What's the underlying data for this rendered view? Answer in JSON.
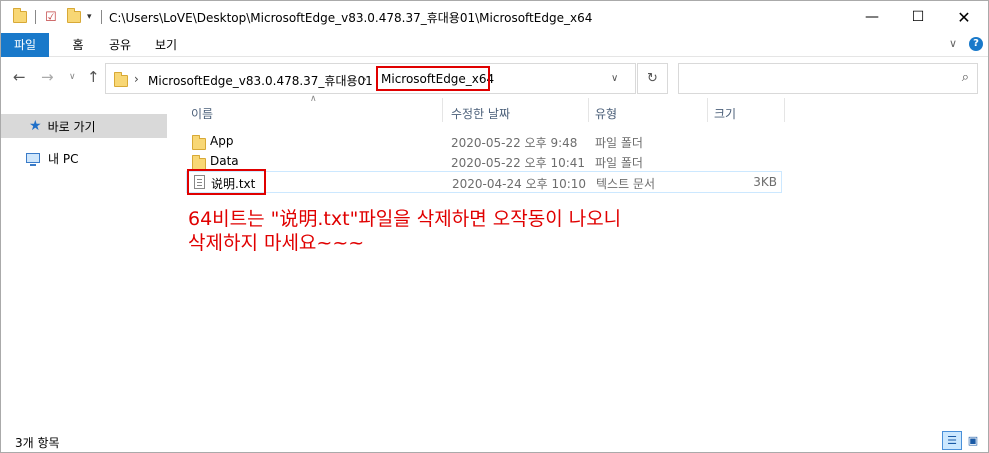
{
  "title_bar": {
    "path": "C:\\Users\\LoVE\\Desktop\\MicrosoftEdge_v83.0.478.37_휴대용01\\MicrosoftEdge_x64",
    "minimize_icon": "minimize-icon",
    "maximize_icon": "maximize-icon",
    "close_icon": "close-icon"
  },
  "ribbon": {
    "tabs": [
      {
        "label": "파일"
      },
      {
        "label": "홈"
      },
      {
        "label": "공유"
      },
      {
        "label": "보기"
      }
    ],
    "accent": "#1979ca"
  },
  "address_bar": {
    "crumbs": [
      "MicrosoftEdge_v83.0.478.37_휴대용01",
      "MicrosoftEdge_x64"
    ],
    "highlight_color": "#e00000"
  },
  "nav_pane": {
    "items": [
      {
        "label": "바로 가기",
        "icon": "star-icon"
      },
      {
        "label": "내 PC",
        "icon": "computer-icon"
      }
    ]
  },
  "columns": {
    "name": "이름",
    "date": "수정한 날짜",
    "type": "유형",
    "size": "크기"
  },
  "files": [
    {
      "name": "App",
      "date": "2020-05-22 오후 9:48",
      "type": "파일 폴더",
      "size": "",
      "icon": "folder-icon"
    },
    {
      "name": "Data",
      "date": "2020-05-22 오후 10:41",
      "type": "파일 폴더",
      "size": "",
      "icon": "folder-icon"
    },
    {
      "name": "说明.txt",
      "date": "2020-04-24 오후 10:10",
      "type": "텍스트 문서",
      "size": "3KB",
      "icon": "text-file-icon"
    }
  ],
  "annotation": {
    "line1": "64비트는 \"说明.txt\"파일을 삭제하면 오작동이 나오니",
    "line2": "삭제하지 마세요~~~",
    "color": "#e00000"
  },
  "status_bar": {
    "item_count": "3개 항목"
  }
}
